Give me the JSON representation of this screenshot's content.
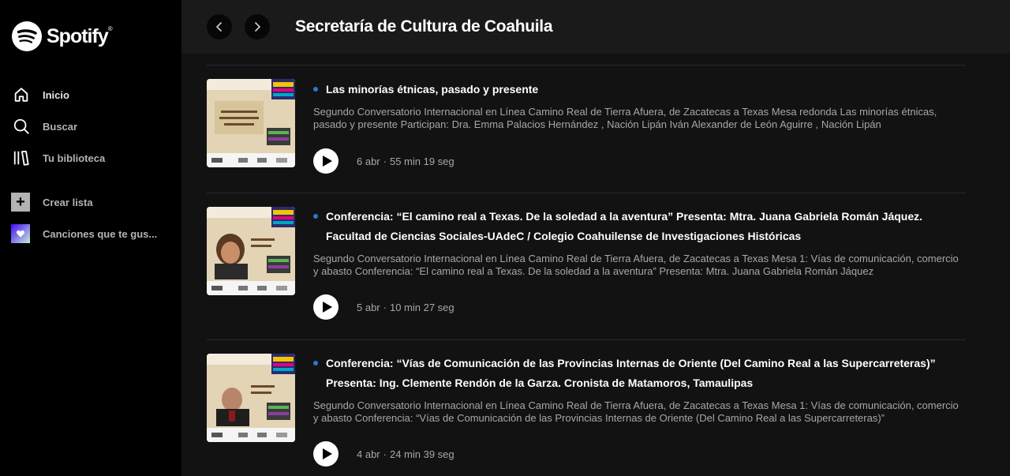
{
  "app": {
    "brand": "Spotify",
    "brand_mark": "®"
  },
  "sidebar": {
    "nav": [
      {
        "label": "Inicio",
        "icon": "home-icon"
      },
      {
        "label": "Buscar",
        "icon": "search-icon"
      },
      {
        "label": "Tu biblioteca",
        "icon": "library-icon"
      }
    ],
    "create_playlist": "Crear lista",
    "liked_songs": "Canciones que te gus..."
  },
  "header": {
    "title": "Secretaría de Cultura de Coahuila"
  },
  "episodes": [
    {
      "title": "Las minorías étnicas, pasado y presente",
      "description": "Segundo Conversatorio Internacional en Línea Camino Real de Tierra Afuera, de Zacatecas a Texas Mesa redonda Las minorías étnicas, pasado y presente Participan:  Dra. Emma Palacios Hernández , Nación Lipán Iván Alexander de León Aguirre , Nación Lipán",
      "date": "6 abr",
      "sep": "·",
      "duration": "55 min 19 seg"
    },
    {
      "title": "Conferencia: “El camino real a Texas. De la soledad a la aventura” Presenta: Mtra. Juana Gabriela Román Jáquez. Facultad de Ciencias Sociales-UAdeC / Colegio Coahuilense de Investigaciones Históricas",
      "description": "Segundo Conversatorio Internacional en Línea Camino Real de Tierra Afuera, de Zacatecas a Texas Mesa 1: Vías de comunicación, comercio y abasto Conferencia: “El camino real a Texas. De la soledad a la aventura” Presenta: Mtra. Juana Gabriela Román Jáquez",
      "date": "5 abr",
      "sep": "·",
      "duration": "10 min 27 seg"
    },
    {
      "title": "Conferencia: “Vías de Comunicación de las Provincias Internas de Oriente (Del Camino Real a las Supercarreteras)” Presenta: Ing. Clemente Rendón de la Garza. Cronista de Matamoros, Tamaulipas",
      "description": "Segundo Conversatorio Internacional en Línea Camino Real de Tierra Afuera, de Zacatecas a Texas Mesa 1: Vías de comunicación, comercio y abasto Conferencia: “Vías de Comunicación de las Provincias Internas de Oriente (Del Camino Real a las Supercarreteras)”",
      "date": "4 abr",
      "sep": "·",
      "duration": "24 min 39 seg"
    }
  ],
  "colors": {
    "accent_unplayed": "#2e77d0",
    "background": "#121212",
    "sidebar": "#000000"
  }
}
